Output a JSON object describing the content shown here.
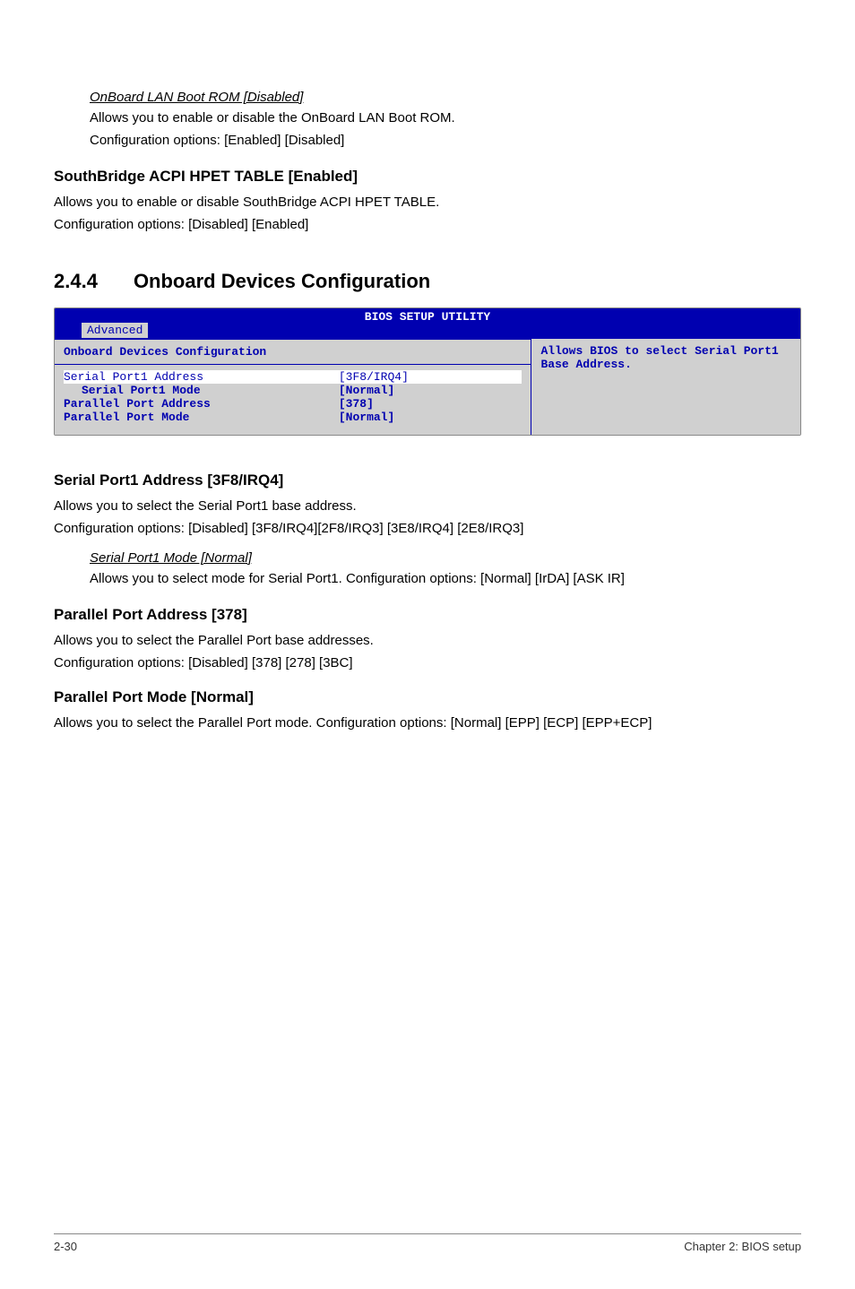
{
  "section1": {
    "heading": "OnBoard LAN Boot ROM [Disabled]",
    "line1": "Allows you to enable or disable the OnBoard LAN Boot ROM.",
    "line2": "Configuration options: [Enabled] [Disabled]"
  },
  "section2": {
    "heading": "SouthBridge ACPI HPET TABLE [Enabled]",
    "line1": "Allows you to enable or disable SouthBridge ACPI HPET TABLE.",
    "line2": "Configuration options: [Disabled] [Enabled]"
  },
  "section3": {
    "number": "2.4.4",
    "title": "Onboard Devices Configuration"
  },
  "bios": {
    "header": "BIOS SETUP UTILITY",
    "tab": "Advanced",
    "panel_title": "Onboard Devices Configuration",
    "help": "Allows BIOS to select Serial Port1 Base Address.",
    "rows": [
      {
        "label": "Serial Port1 Address",
        "value": "[3F8/IRQ4]",
        "selected": true,
        "indent": false
      },
      {
        "label": "Serial Port1 Mode",
        "value": "[Normal]",
        "selected": false,
        "indent": true
      },
      {
        "label": "Parallel Port Address",
        "value": "[378]",
        "selected": false,
        "indent": false
      },
      {
        "label": "Parallel Port Mode",
        "value": "[Normal]",
        "selected": false,
        "indent": false
      }
    ]
  },
  "section4": {
    "heading": "Serial Port1 Address [3F8/IRQ4]",
    "line1": "Allows you to select the Serial Port1 base address.",
    "line2": "Configuration options: [Disabled] [3F8/IRQ4][2F8/IRQ3] [3E8/IRQ4] [2E8/IRQ3]"
  },
  "section5": {
    "heading": "Serial Port1 Mode [Normal]",
    "line1": "Allows you to select mode for Serial Port1. Configuration options: [Normal] [IrDA] [ASK IR]"
  },
  "section6": {
    "heading": "Parallel Port Address [378]",
    "line1": "Allows you to select the Parallel Port base addresses.",
    "line2": "Configuration options: [Disabled] [378] [278] [3BC]"
  },
  "section7": {
    "heading": "Parallel Port Mode [Normal]",
    "line1": "Allows you to select the Parallel Port  mode. Configuration options: [Normal] [EPP] [ECP] [EPP+ECP]"
  },
  "footer": {
    "left": "2-30",
    "right": "Chapter 2: BIOS setup"
  }
}
